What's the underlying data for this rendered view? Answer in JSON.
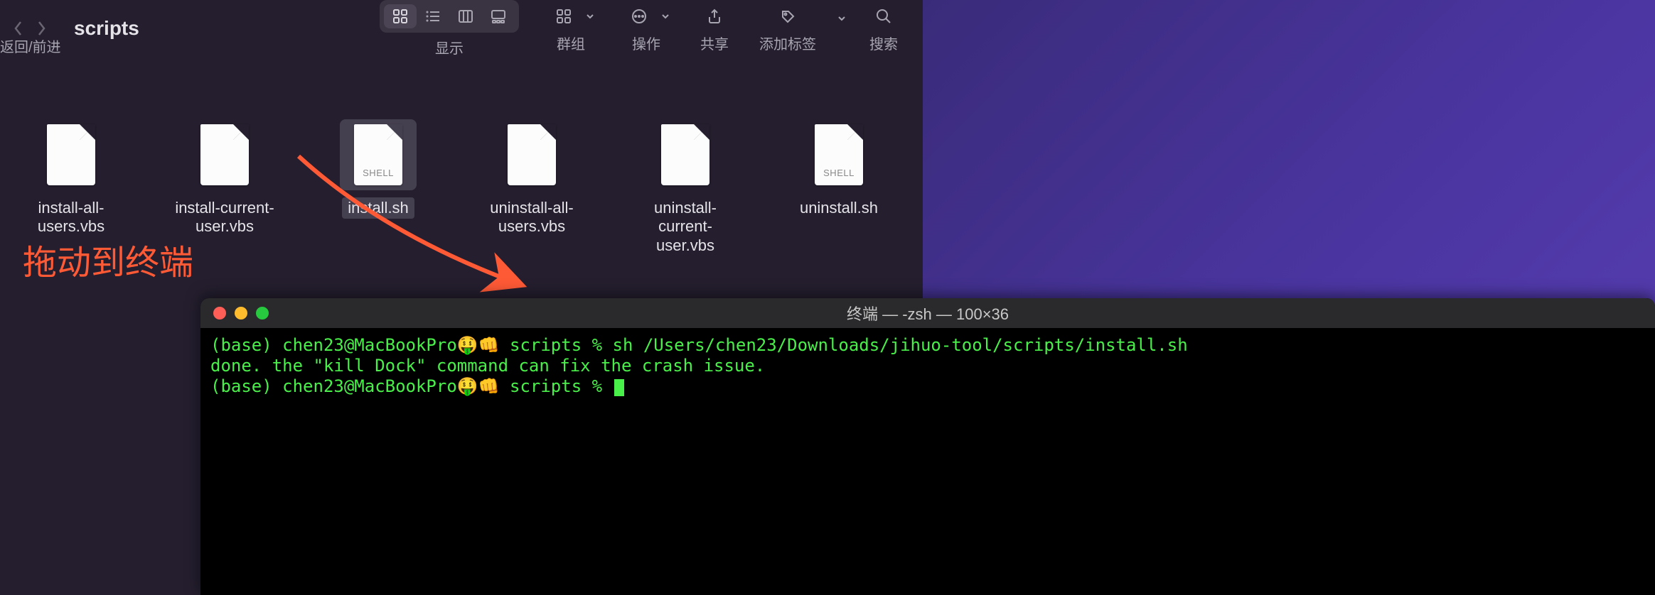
{
  "finder": {
    "folder_title": "scripts",
    "nav_sublabel": "返回/前进",
    "toolbar_labels": {
      "view": "显示",
      "group": "群组",
      "action": "操作",
      "share": "共享",
      "tags": "添加标签",
      "search": "搜索"
    },
    "files": [
      {
        "name": "install-all-users.vbs",
        "badge": "",
        "selected": false,
        "hasContent": false
      },
      {
        "name": "install-current-user.vbs",
        "badge": "",
        "selected": false,
        "hasContent": false
      },
      {
        "name": "install.sh",
        "badge": "SHELL",
        "selected": true,
        "hasContent": true
      },
      {
        "name": "uninstall-all-users.vbs",
        "badge": "",
        "selected": false,
        "hasContent": false
      },
      {
        "name": "uninstall-current-user.vbs",
        "badge": "",
        "selected": false,
        "hasContent": false
      },
      {
        "name": "uninstall.sh",
        "badge": "SHELL",
        "selected": false,
        "hasContent": true
      }
    ]
  },
  "annotation_text": "拖动到终端",
  "terminal": {
    "title": "终端 — -zsh — 100×36",
    "lines": [
      "(base) chen23@MacBookPro🤑👊 scripts % sh /Users/chen23/Downloads/jihuo-tool/scripts/install.sh",
      "done. the \"kill Dock\" command can fix the crash issue.",
      "(base) chen23@MacBookPro🤑👊 scripts % "
    ]
  },
  "colors": {
    "annotation": "#ff5a36",
    "terminal_text": "#4af04a"
  }
}
